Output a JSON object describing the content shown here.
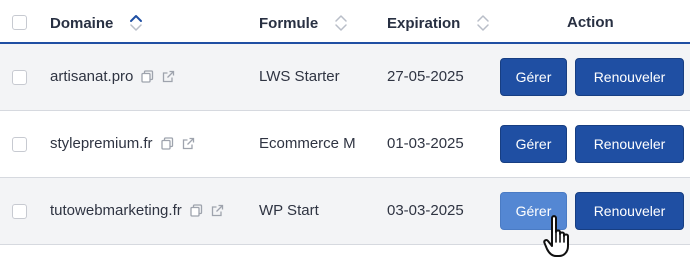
{
  "header": {
    "domain": "Domaine",
    "formule": "Formule",
    "expiration": "Expiration",
    "action": "Action"
  },
  "rows": [
    {
      "domain": "artisanat.pro",
      "formule": "LWS Starter",
      "expiration": "27-05-2025",
      "manage": "Gérer",
      "renew": "Renouveler"
    },
    {
      "domain": "stylepremium.fr",
      "formule": "Ecommerce M",
      "expiration": "01-03-2025",
      "manage": "Gérer",
      "renew": "Renouveler"
    },
    {
      "domain": "tutowebmarketing.fr",
      "formule": "WP Start",
      "expiration": "03-03-2025",
      "manage": "Gérer",
      "renew": "Renouveler"
    }
  ],
  "colors": {
    "primary": "#1f4fa3",
    "primary_hover": "#5487d3",
    "header_border": "#1f4fa3",
    "row_alt": "#f3f4f6"
  },
  "icons": [
    "checkbox",
    "sort-icon",
    "copy-icon",
    "external-link-icon",
    "hand-cursor-icon"
  ]
}
